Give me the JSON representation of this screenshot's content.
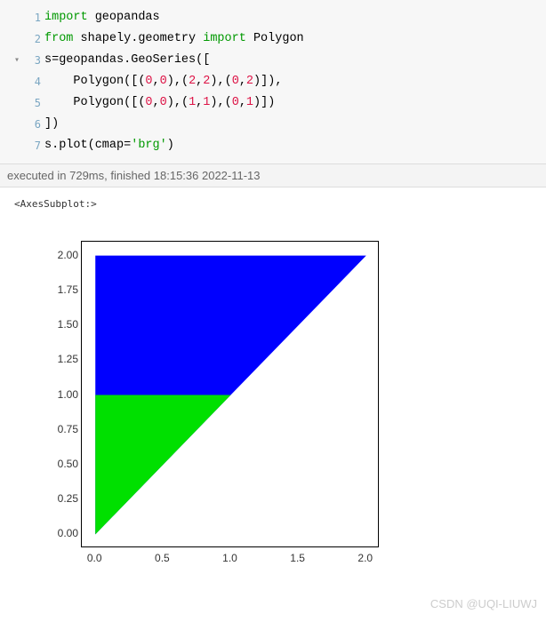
{
  "code": {
    "lines": [
      {
        "n": "1",
        "gutter": "",
        "html": "<span class='kw'>import</span> geopandas"
      },
      {
        "n": "2",
        "gutter": "",
        "html": "<span class='kw'>from</span> shapely.geometry <span class='kw'>import</span> Polygon"
      },
      {
        "n": "3",
        "gutter": "▾",
        "html": "s=geopandas.GeoSeries(["
      },
      {
        "n": "4",
        "gutter": "",
        "html": "    Polygon([(<span class='num'>0</span>,<span class='num'>0</span>),(<span class='num'>2</span>,<span class='num'>2</span>),(<span class='num'>0</span>,<span class='num'>2</span>)]),"
      },
      {
        "n": "5",
        "gutter": "",
        "html": "    Polygon([(<span class='num'>0</span>,<span class='num'>0</span>),(<span class='num'>1</span>,<span class='num'>1</span>),(<span class='num'>0</span>,<span class='num'>1</span>)])"
      },
      {
        "n": "6",
        "gutter": "",
        "html": "])"
      },
      {
        "n": "7",
        "gutter": "",
        "html": "s.plot(cmap=<span class='str-g'>'brg'</span>)"
      }
    ]
  },
  "exec_status": "executed in 729ms, finished 18:15:36 2022-11-13",
  "repr": "<AxesSubplot:>",
  "watermark": "CSDN @UQI-LIUWJ",
  "chart_data": {
    "type": "area",
    "series": [
      {
        "name": "poly-blue",
        "color": "#0000ff",
        "points": [
          [
            0,
            0
          ],
          [
            2,
            2
          ],
          [
            0,
            2
          ]
        ]
      },
      {
        "name": "poly-green",
        "color": "#00e000",
        "points": [
          [
            0,
            0
          ],
          [
            1,
            1
          ],
          [
            0,
            1
          ]
        ]
      }
    ],
    "xticks": [
      "0.0",
      "0.5",
      "1.0",
      "1.5",
      "2.0"
    ],
    "yticks": [
      "0.00",
      "0.25",
      "0.50",
      "0.75",
      "1.00",
      "1.25",
      "1.50",
      "1.75",
      "2.00"
    ],
    "xlim": [
      -0.1,
      2.1
    ],
    "ylim": [
      -0.1,
      2.1
    ],
    "title": "",
    "xlabel": "",
    "ylabel": ""
  }
}
